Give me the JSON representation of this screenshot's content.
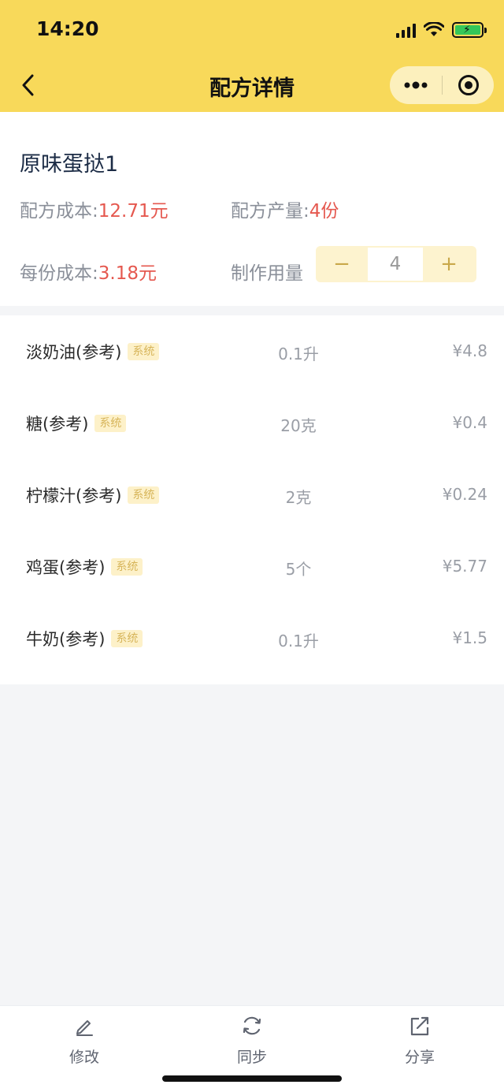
{
  "status_bar": {
    "time": "14:20"
  },
  "nav": {
    "title": "配方详情"
  },
  "recipe": {
    "name": "原味蛋挞1",
    "cost_label": "配方成本:",
    "cost_value": "12.71元",
    "yield_label": "配方产量:",
    "yield_value": "4份",
    "unit_cost_label": "每份成本:",
    "unit_cost_value": "3.18元",
    "make_qty_label": "制作用量",
    "stepper": {
      "minus": "−",
      "value": "4",
      "plus": "+"
    }
  },
  "ingredients": [
    {
      "name": "淡奶油(参考)",
      "tag": "系统",
      "qty": "0.1升",
      "price": "¥4.8"
    },
    {
      "name": "糖(参考)",
      "tag": "系统",
      "qty": "20克",
      "price": "¥0.4"
    },
    {
      "name": "柠檬汁(参考)",
      "tag": "系统",
      "qty": "2克",
      "price": "¥0.24"
    },
    {
      "name": "鸡蛋(参考)",
      "tag": "系统",
      "qty": "5个",
      "price": "¥5.77"
    },
    {
      "name": "牛奶(参考)",
      "tag": "系统",
      "qty": "0.1升",
      "price": "¥1.5"
    }
  ],
  "bottom_bar": {
    "edit": {
      "label": "修改",
      "icon": "pencil-icon"
    },
    "sync": {
      "label": "同步",
      "icon": "sync-icon"
    },
    "share": {
      "label": "分享",
      "icon": "share-icon"
    }
  },
  "colors": {
    "header": "#f8d95a",
    "accent_red": "#e5584f",
    "tag_bg": "#fdf1c9",
    "tag_text": "#d7b55a"
  }
}
